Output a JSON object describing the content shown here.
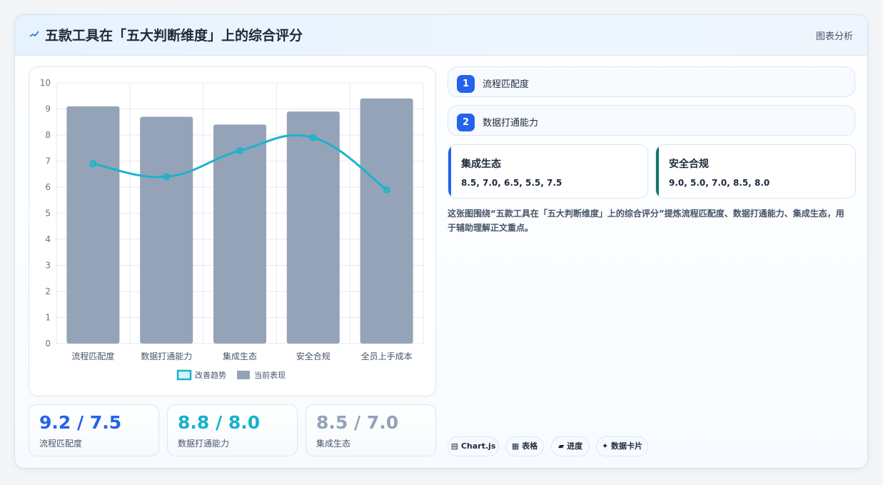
{
  "header": {
    "title": "五款工具在「五大判断维度」上的综合评分",
    "icon": "chart-spark-icon",
    "tag": "图表分析"
  },
  "chart_data": {
    "type": "bar",
    "categories": [
      "流程匹配度",
      "数据打通能力",
      "集成生态",
      "安全合规",
      "全员上手成本"
    ],
    "ylim": [
      0,
      10
    ],
    "yticks": [
      0,
      1,
      2,
      3,
      4,
      5,
      6,
      7,
      8,
      9,
      10
    ],
    "grid": true,
    "legend_position": "bottom",
    "series": [
      {
        "name": "当前表现",
        "type": "bar",
        "color": "#94a3b8",
        "values": [
          9.1,
          8.7,
          8.4,
          8.9,
          9.4
        ]
      },
      {
        "name": "改善趋势",
        "type": "line",
        "color": "#1bb3cc",
        "values": [
          6.9,
          6.4,
          7.4,
          7.9,
          5.9
        ]
      }
    ]
  },
  "stats": [
    {
      "value": "9.2 / 7.5",
      "label": "流程匹配度",
      "color": "#2563eb"
    },
    {
      "value": "8.8 / 8.0",
      "label": "数据打通能力",
      "color": "#16b2c9"
    },
    {
      "value": "8.5 / 7.0",
      "label": "集成生态",
      "color": "#94a3b8"
    }
  ],
  "pills": [
    {
      "num": "1",
      "label": "流程匹配度"
    },
    {
      "num": "2",
      "label": "数据打通能力"
    }
  ],
  "mini_cards": [
    {
      "title": "集成生态",
      "values": "8.5, 7.0, 6.5, 5.5, 7.5",
      "accent": "#2563eb"
    },
    {
      "title": "安全合规",
      "values": "9.0, 5.0, 7.0, 8.5, 8.0",
      "accent": "#0f766e"
    }
  ],
  "description": "这张图围绕“五款工具在「五大判断维度」上的综合评分”提炼流程匹配度、数据打通能力、集成生态，用于辅助理解正文重点。",
  "chips": [
    {
      "icon": "chart-icon",
      "glyph": "▤",
      "label": "Chart.js"
    },
    {
      "icon": "table-icon",
      "glyph": "▦",
      "label": "表格"
    },
    {
      "icon": "progress-icon",
      "glyph": "▰",
      "label": "进度"
    },
    {
      "icon": "sparkle-icon",
      "glyph": "✦",
      "label": "数据卡片"
    }
  ]
}
